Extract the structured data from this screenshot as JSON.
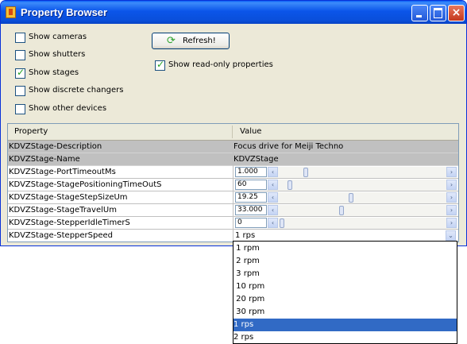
{
  "window": {
    "title": "Property Browser",
    "accent": "#0a4fda"
  },
  "filters": {
    "show_cameras": {
      "label": "Show cameras",
      "checked": false
    },
    "show_shutters": {
      "label": "Show shutters",
      "checked": false
    },
    "show_stages": {
      "label": "Show stages",
      "checked": true
    },
    "show_discrete_changers": {
      "label": "Show discrete changers",
      "checked": false
    },
    "show_other_devices": {
      "label": "Show other devices",
      "checked": false
    },
    "show_read_only": {
      "label": "Show read-only properties",
      "checked": true
    }
  },
  "refresh_button": {
    "label": "Refresh!",
    "icon": "refresh-icon"
  },
  "table": {
    "columns": [
      "Property",
      "Value"
    ],
    "rows": [
      {
        "property": "KDVZStage-Description",
        "value": "Focus drive for Meiji Techno",
        "read_only": true,
        "editor": "text"
      },
      {
        "property": "KDVZStage-Name",
        "value": "KDVZStage",
        "read_only": true,
        "editor": "text"
      },
      {
        "property": "KDVZStage-PortTimeoutMs",
        "value": "1.000",
        "read_only": false,
        "editor": "slider",
        "level": 0.15
      },
      {
        "property": "KDVZStage-StagePositioningTimeOutS",
        "value": "60",
        "read_only": false,
        "editor": "slider",
        "level": 0.05
      },
      {
        "property": "KDVZStage-StageStepSizeUm",
        "value": "19.25",
        "read_only": false,
        "editor": "slider",
        "level": 0.43
      },
      {
        "property": "KDVZStage-StageTravelUm",
        "value": "33.000",
        "read_only": false,
        "editor": "slider",
        "level": 0.37
      },
      {
        "property": "KDVZStage-StepperIdleTimerS",
        "value": "0",
        "read_only": false,
        "editor": "slider",
        "level": 0.0
      },
      {
        "property": "KDVZStage-StepperSpeed",
        "value": "1 rps",
        "read_only": false,
        "editor": "dropdown"
      }
    ]
  },
  "speed_dropdown": {
    "options": [
      " 1 rpm",
      " 2 rpm",
      " 3 rpm",
      " 10 rpm",
      " 20 rpm",
      " 30 rpm",
      "1 rps",
      "2 rps"
    ],
    "selected_index": 6
  },
  "icons": {
    "left_arrow": "‹",
    "right_arrow": "›",
    "down_arrow": "⌄"
  }
}
